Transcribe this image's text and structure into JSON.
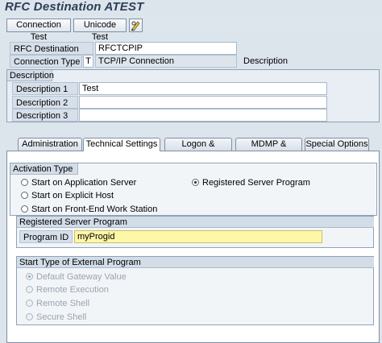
{
  "window": {
    "title": "RFC Destination ATEST"
  },
  "toolbar": {
    "connection_test": "Connection Test",
    "unicode_test": "Unicode Test"
  },
  "header": {
    "rfc_destination_label": "RFC Destination",
    "rfc_destination_value": "RFCTCPIP",
    "connection_type_label": "Connection Type",
    "connection_type_code": "T",
    "connection_type_text": "TCP/IP Connection",
    "description_label": "Description"
  },
  "description": {
    "title": "Description",
    "rows": [
      {
        "label": "Description 1",
        "value": "Test"
      },
      {
        "label": "Description 2",
        "value": ""
      },
      {
        "label": "Description 3",
        "value": ""
      }
    ]
  },
  "tabs": [
    {
      "label": "Administration"
    },
    {
      "label": "Technical Settings"
    },
    {
      "label": "Logon & Security"
    },
    {
      "label": "MDMP & Unicode"
    },
    {
      "label": "Special Options"
    }
  ],
  "activation": {
    "title": "Activation Type",
    "options": [
      {
        "label": "Start on Application Server",
        "selected": false
      },
      {
        "label": "Registered Server Program",
        "selected": true
      },
      {
        "label": "Start on Explicit Host",
        "selected": false
      },
      {
        "label": "Start on Front-End Work Station",
        "selected": false
      }
    ]
  },
  "registered": {
    "title": "Registered Server Program",
    "program_id_label": "Program ID",
    "program_id_value": "myProgid"
  },
  "external": {
    "title": "Start Type of External Program",
    "options": [
      {
        "label": "Default Gateway Value",
        "selected": true
      },
      {
        "label": "Remote Execution",
        "selected": false
      },
      {
        "label": "Remote Shell",
        "selected": false
      },
      {
        "label": "Secure Shell",
        "selected": false
      }
    ]
  },
  "colors": {
    "program_id_bg": "#fff7a8",
    "title_color": "#2c3e56"
  }
}
